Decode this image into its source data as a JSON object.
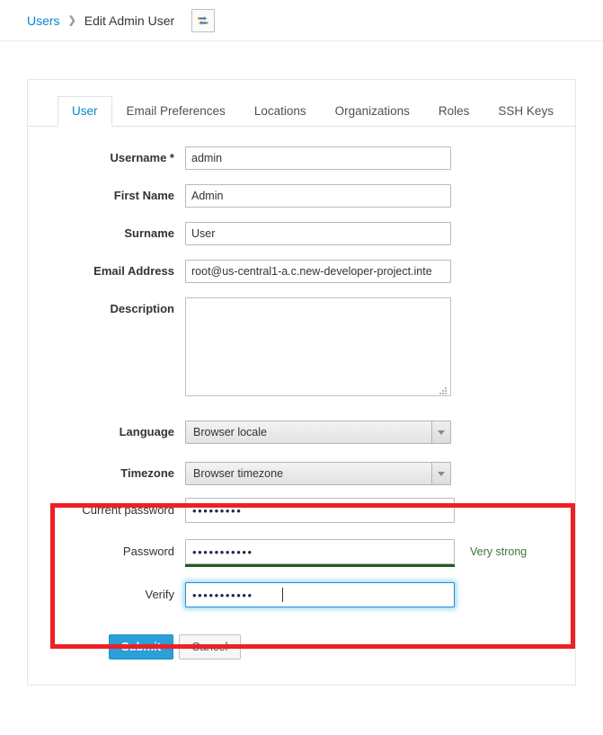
{
  "breadcrumb": {
    "parent_label": "Users",
    "separator": "❯",
    "current_label": "Edit Admin User",
    "swap_icon": "exchange-arrows-icon"
  },
  "tabs": [
    {
      "label": "User",
      "active": true
    },
    {
      "label": "Email Preferences",
      "active": false
    },
    {
      "label": "Locations",
      "active": false
    },
    {
      "label": "Organizations",
      "active": false
    },
    {
      "label": "Roles",
      "active": false
    },
    {
      "label": "SSH Keys",
      "active": false
    }
  ],
  "form": {
    "username": {
      "label": "Username *",
      "value": "admin",
      "placeholder": ""
    },
    "first_name": {
      "label": "First Name",
      "value": "Admin",
      "placeholder": ""
    },
    "surname": {
      "label": "Surname",
      "value": "User",
      "placeholder": ""
    },
    "email": {
      "label": "Email Address",
      "value": "root@us-central1-a.c.new-developer-project.inte",
      "placeholder": ""
    },
    "description": {
      "label": "Description",
      "value": "",
      "placeholder": ""
    },
    "language": {
      "label": "Language",
      "value": "Browser locale"
    },
    "timezone": {
      "label": "Timezone",
      "value": "Browser timezone"
    }
  },
  "password_section": {
    "current_password": {
      "label": "Current password",
      "value": "•••••••••",
      "placeholder": ""
    },
    "password": {
      "label": "Password",
      "value": "•••••••••••",
      "placeholder": ""
    },
    "verify": {
      "label": "Verify",
      "value": "•••••••••••",
      "placeholder": ""
    },
    "strength_label": "Very strong",
    "strength_color": "#3c763d",
    "strength_bar_color": "#1f5c1f",
    "highlight_color": "#ed2024"
  },
  "actions": {
    "submit_label": "Submit",
    "cancel_label": "Cancel"
  }
}
